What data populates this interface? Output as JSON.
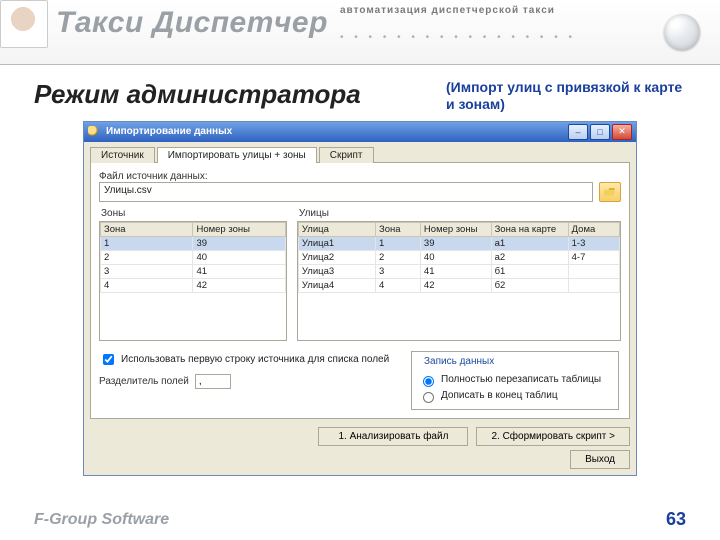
{
  "header": {
    "brand": "Такси Диспетчер",
    "tagline": "автоматизация диспетчерской такси"
  },
  "page": {
    "title": "Режим администратора",
    "subtitle": "(Импорт улиц с привязкой к карте и зонам)"
  },
  "win": {
    "title": "Импортирование данных",
    "tabs": [
      "Источник",
      "Импортировать улицы + зоны",
      "Скрипт"
    ],
    "active_tab": 1,
    "file_label": "Файл источник данных:",
    "file_value": "Улицы.csv",
    "zones_title": "Зоны",
    "streets_title": "Улицы",
    "zones_cols": [
      "Зона",
      "Номер зоны"
    ],
    "zones_rows": [
      [
        "1",
        "39"
      ],
      [
        "2",
        "40"
      ],
      [
        "3",
        "41"
      ],
      [
        "4",
        "42"
      ]
    ],
    "streets_cols": [
      "Улица",
      "Зона",
      "Номер зоны",
      "Зона на карте",
      "Дома"
    ],
    "streets_rows": [
      [
        "Улица1",
        "1",
        "39",
        "a1",
        "1-3"
      ],
      [
        "Улица2",
        "2",
        "40",
        "a2",
        "4-7"
      ],
      [
        "Улица3",
        "3",
        "41",
        "б1",
        ""
      ],
      [
        "Улица4",
        "4",
        "42",
        "б2",
        ""
      ]
    ],
    "chk_firstrow": "Использовать первую строку источника для списка полей",
    "sep_label": "Разделитель полей",
    "sep_value": ",",
    "group_title": "Запись данных",
    "radio1": "Полностью перезаписать таблицы",
    "radio2": "Дописать в конец таблиц",
    "btn_analyze": "1. Анализировать файл",
    "btn_script": "2. Сформировать скрипт >",
    "btn_exit": "Выход"
  },
  "footer": {
    "company": "F-Group Software",
    "page": "63"
  }
}
